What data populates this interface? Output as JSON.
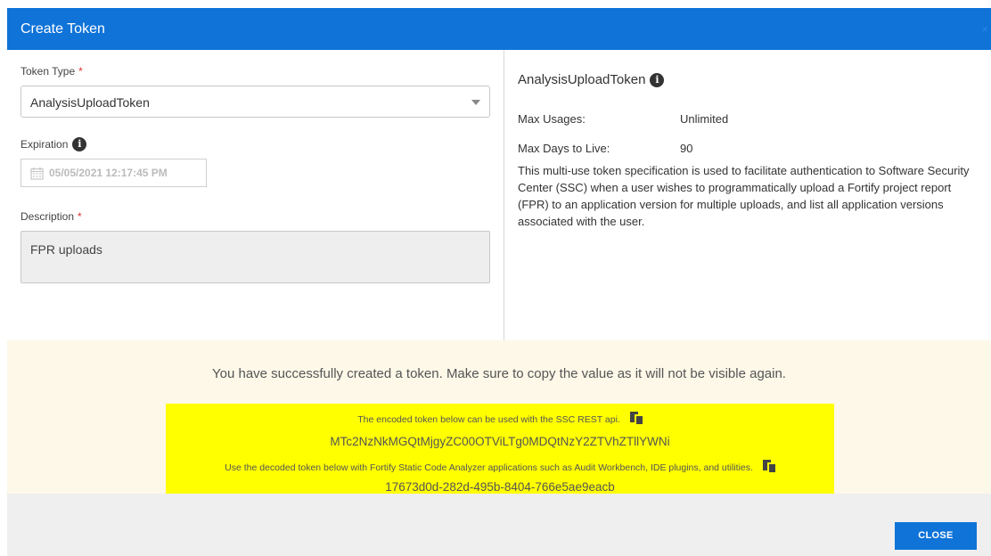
{
  "dialog": {
    "title": "Create Token",
    "close_icon": "×"
  },
  "left": {
    "token_type_label": "Token Type",
    "required_marker": "*",
    "token_type_value": "AnalysisUploadToken",
    "expiration_label": "Expiration",
    "expiration_value": "05/05/2021 12:17:45 PM",
    "description_label": "Description",
    "description_value": "FPR uploads"
  },
  "right": {
    "title": "AnalysisUploadToken",
    "max_usages_label": "Max Usages:",
    "max_usages_value": "Unlimited",
    "max_days_label": "Max Days to Live:",
    "max_days_value": "90",
    "description": "This multi-use token specification is used to facilitate authentication to Software Security Center (SSC) when a user wishes to programmatically upload a Fortify project report (FPR) to an application version for multiple uploads, and list all application versions associated with the user."
  },
  "success": {
    "message": "You have successfully created a token. Make sure to copy the value as it will not be visible again.",
    "encoded_note": "The encoded token below can be used with the SSC REST api.",
    "encoded_token": "MTc2NzNkMGQtMjgyZC00OTViLTg0MDQtNzY2ZTVhZTllYWNi",
    "decoded_note": "Use the decoded token below with Fortify Static Code Analyzer applications such as Audit Workbench, IDE plugins, and utilities.",
    "decoded_token": "17673d0d-282d-495b-8404-766e5ae9eacb"
  },
  "footer": {
    "close_label": "CLOSE"
  },
  "icons": {
    "info": "info-icon",
    "calendar": "calendar-icon",
    "copy": "copy-icon",
    "dropdown": "chevron-down-icon",
    "close": "close-icon"
  },
  "colors": {
    "accent": "#0f73d8",
    "required": "#e0322f",
    "highlight": "#ffff00",
    "success_bg": "#fdf8e8"
  }
}
